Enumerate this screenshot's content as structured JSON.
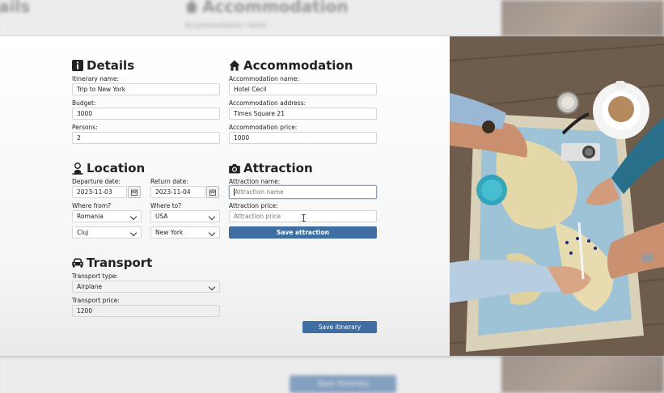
{
  "backdrop": {
    "details_title": "ails",
    "accommodation_title": "Accommodation",
    "accommodation_sub": "Accommodation name",
    "save_itinerary_label": "Save itinerary"
  },
  "details": {
    "title": "Details",
    "itinerary_name_label": "Itinerary name:",
    "itinerary_name_value": "Trip to New York",
    "budget_label": "Budget:",
    "budget_value": "3000",
    "persons_label": "Persons:",
    "persons_value": "2"
  },
  "accommodation": {
    "title": "Accommodation",
    "name_label": "Accommodation name:",
    "name_value": "Hotel Cecil",
    "address_label": "Accommodation address:",
    "address_value": "Times Square 21",
    "price_label": "Accommodation price:",
    "price_value": "1000"
  },
  "location": {
    "title": "Location",
    "departure_label": "Departure date:",
    "departure_value": "2023-11-03",
    "return_label": "Return date:",
    "return_value": "2023-11-04",
    "where_from_label": "Where from?",
    "where_from_country": "Romania",
    "where_from_city": "Cluj",
    "where_to_label": "Where to?",
    "where_to_country": "USA",
    "where_to_city": "New York"
  },
  "attraction": {
    "title": "Attraction",
    "name_label": "Attraction name:",
    "name_placeholder": "Attraction name",
    "price_label": "Attraction price:",
    "price_placeholder": "Attraction price",
    "save_label": "Save attraction"
  },
  "transport": {
    "title": "Transport",
    "type_label": "Transport type:",
    "type_value": "Airplane",
    "price_label": "Transport price:",
    "price_value": "1200"
  },
  "footer": {
    "save_itinerary_label": "Save itinerary"
  },
  "colors": {
    "primary_button": "#3f6ea3",
    "focus_border": "#7fa4d2"
  },
  "icons": {
    "details": "info-icon",
    "accommodation": "house-icon",
    "location": "person-pin-icon",
    "attraction": "camera-icon",
    "transport": "car-icon",
    "calendar": "calendar-icon",
    "dropdown": "chevron-down-icon"
  }
}
